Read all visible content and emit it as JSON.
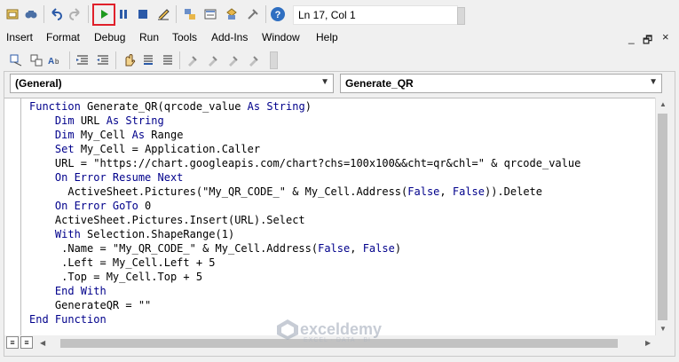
{
  "status": {
    "position": "Ln 17, Col 1"
  },
  "menu": [
    "Insert",
    "Format",
    "Debug",
    "Run",
    "Tools",
    "Add-Ins",
    "Window",
    "Help"
  ],
  "combos": {
    "object": "(General)",
    "procedure": "Generate_QR"
  },
  "code_lines": [
    [
      [
        "kw",
        "Function "
      ],
      [
        "nm",
        "Generate_QR(qrcode_value "
      ],
      [
        "kw",
        "As String"
      ],
      [
        "nm",
        ")"
      ]
    ],
    [
      [
        "nm",
        "    "
      ],
      [
        "kw",
        "Dim"
      ],
      [
        "nm",
        " URL "
      ],
      [
        "kw",
        "As String"
      ]
    ],
    [
      [
        "nm",
        "    "
      ],
      [
        "kw",
        "Dim"
      ],
      [
        "nm",
        " My_Cell "
      ],
      [
        "kw",
        "As"
      ],
      [
        "nm",
        " Range"
      ]
    ],
    [
      [
        "nm",
        "    "
      ],
      [
        "kw",
        "Set"
      ],
      [
        "nm",
        " My_Cell = Application.Caller"
      ]
    ],
    [
      [
        "nm",
        "    URL = \"https://chart.googleapis.com/chart?chs=100x100&&cht=qr&chl=\" & qrcode_value"
      ]
    ],
    [
      [
        "nm",
        "    "
      ],
      [
        "kw",
        "On Error Resume Next"
      ]
    ],
    [
      [
        "nm",
        "      ActiveSheet.Pictures(\"My_QR_CODE_\" & My_Cell.Address("
      ],
      [
        "kw",
        "False"
      ],
      [
        "nm",
        ", "
      ],
      [
        "kw",
        "False"
      ],
      [
        "nm",
        ")).Delete"
      ]
    ],
    [
      [
        "nm",
        "    "
      ],
      [
        "kw",
        "On Error GoTo"
      ],
      [
        "nm",
        " 0"
      ]
    ],
    [
      [
        "nm",
        "    ActiveSheet.Pictures.Insert(URL).Select"
      ]
    ],
    [
      [
        "nm",
        "    "
      ],
      [
        "kw",
        "With"
      ],
      [
        "nm",
        " Selection.ShapeRange(1)"
      ]
    ],
    [
      [
        "nm",
        "     .Name = \"My_QR_CODE_\" & My_Cell.Address("
      ],
      [
        "kw",
        "False"
      ],
      [
        "nm",
        ", "
      ],
      [
        "kw",
        "False"
      ],
      [
        "nm",
        ")"
      ]
    ],
    [
      [
        "nm",
        "     .Left = My_Cell.Left + 5"
      ]
    ],
    [
      [
        "nm",
        "     .Top = My_Cell.Top + 5"
      ]
    ],
    [
      [
        "nm",
        "    "
      ],
      [
        "kw",
        "End With"
      ]
    ],
    [
      [
        "nm",
        "    GenerateQR = \"\""
      ]
    ],
    [
      [
        "kw",
        "End Function"
      ]
    ]
  ],
  "watermark": {
    "name": "exceldemy",
    "tagline": "EXCEL · DATA · BI"
  },
  "colors": {
    "keyword": "#00008b",
    "run_highlight": "#e0202a",
    "run_icon": "#1e9a1e"
  },
  "icons": {
    "toolbar1": [
      "view-excel-icon",
      "find-icon",
      "undo-icon",
      "redo-icon",
      "run-icon",
      "break-icon",
      "reset-icon",
      "design-mode-icon",
      "project-explorer-icon",
      "properties-icon",
      "object-browser-icon",
      "toolbox-icon",
      "help-icon"
    ],
    "toolbar2": [
      "indent-icon",
      "outdent-icon",
      "toggle-breakpoint-icon",
      "comment-block-icon",
      "uncomment-block-icon",
      "bookmark-icon",
      "next-bookmark-icon",
      "prev-bookmark-icon",
      "clear-bookmarks-icon",
      "list-properties-icon",
      "quick-info-icon",
      "parameter-info-icon",
      "complete-word-icon"
    ]
  }
}
